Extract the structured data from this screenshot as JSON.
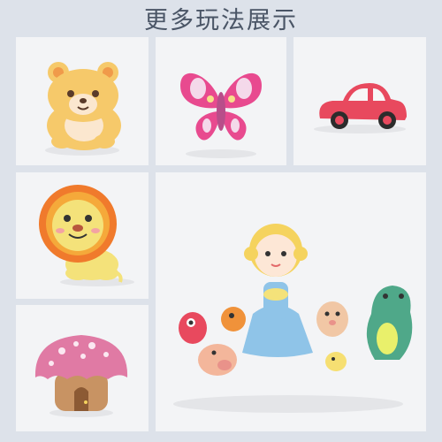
{
  "header": {
    "title": "更多玩法展示"
  },
  "gallery": {
    "items": [
      {
        "subject": "bear-figure"
      },
      {
        "subject": "butterfly-figure"
      },
      {
        "subject": "car-figure"
      },
      {
        "subject": "lion-figure"
      },
      {
        "subject": "mushroom-house-figure"
      },
      {
        "subject": "doll-and-animals-group"
      }
    ]
  },
  "colors": {
    "page_background": "#dde2ea",
    "tile_background": "#f3f4f6",
    "title_text": "#4a5566"
  }
}
